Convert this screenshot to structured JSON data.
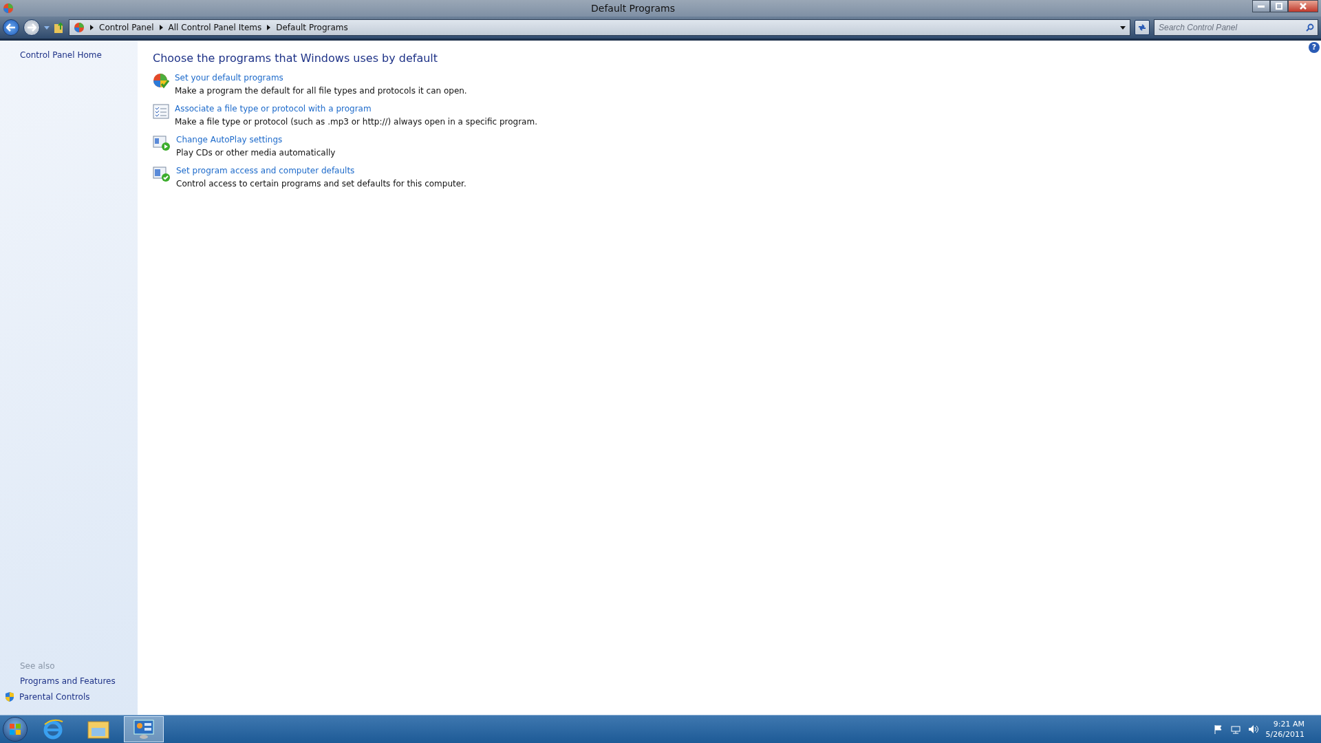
{
  "window": {
    "title": "Default Programs"
  },
  "address_bar": {
    "breadcrumbs": [
      "Control Panel",
      "All Control Panel Items",
      "Default Programs"
    ]
  },
  "search": {
    "placeholder": "Search Control Panel"
  },
  "help_button": "?",
  "sidebar": {
    "items": [
      {
        "label": "Control Panel Home"
      }
    ],
    "see_also": {
      "heading": "See also",
      "items": [
        {
          "label": "Programs and Features",
          "shield": false
        },
        {
          "label": "Parental Controls",
          "shield": true
        }
      ]
    }
  },
  "content": {
    "heading": "Choose the programs that Windows uses by default",
    "tasks": [
      {
        "kind": "default",
        "link": "Set your default programs",
        "description": "Make a program the default for all file types and protocols it can open."
      },
      {
        "kind": "associate",
        "link": "Associate a file type or protocol with a program",
        "description": "Make a file type or protocol (such as .mp3 or http://) always open in a specific program."
      },
      {
        "kind": "autoplay",
        "link": "Change AutoPlay settings",
        "description": "Play CDs or other media automatically"
      },
      {
        "kind": "access",
        "link": "Set program access and computer defaults",
        "description": "Control access to certain programs and set defaults for this computer."
      }
    ]
  },
  "taskbar": {
    "apps": [
      {
        "kind": "browser",
        "selected": false
      },
      {
        "kind": "folder",
        "selected": false
      },
      {
        "kind": "control",
        "selected": true
      }
    ],
    "clock": {
      "time": "9:21 AM",
      "date": "5/26/2011"
    }
  }
}
